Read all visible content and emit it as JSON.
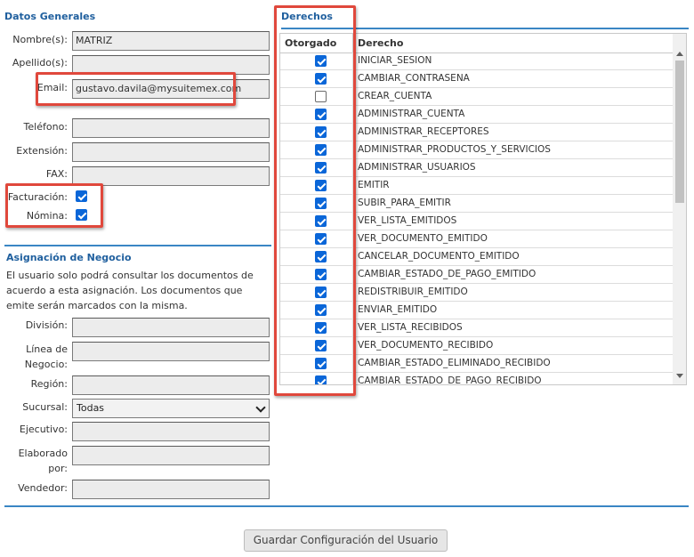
{
  "datos_generales": {
    "title": "Datos Generales",
    "nombre": {
      "label": "Nombre(s):",
      "value": "MATRIZ"
    },
    "apellido": {
      "label": "Apellido(s):",
      "value": ""
    },
    "email": {
      "label": "Email:",
      "value": "gustavo.davila@mysuitemex.com"
    },
    "telefono": {
      "label": "Teléfono:",
      "value": ""
    },
    "extension": {
      "label": "Extensión:",
      "value": ""
    },
    "fax": {
      "label": "FAX:",
      "value": ""
    },
    "facturacion": {
      "label": "Facturación:",
      "checked": true
    },
    "nomina": {
      "label": "Nómina:",
      "checked": true
    }
  },
  "asignacion": {
    "title": "Asignación de Negocio",
    "description": "El usuario solo podrá consultar los documentos de acuerdo a esta asignación. Los documentos que emite serán marcados con la misma.",
    "division": {
      "label": "División:",
      "value": ""
    },
    "linea_1": "Línea de",
    "linea_2": "Negocio:",
    "linea_value": "",
    "region": {
      "label": "Región:",
      "value": ""
    },
    "sucursal": {
      "label": "Sucursal:",
      "value": "Todas"
    },
    "ejecutivo": {
      "label": "Ejecutivo:",
      "value": ""
    },
    "elaborado_1": "Elaborado",
    "elaborado_2": "por:",
    "elaborado_value": "",
    "vendedor": {
      "label": "Vendedor:",
      "value": ""
    }
  },
  "derechos": {
    "title": "Derechos",
    "col_otorgado": "Otorgado",
    "col_derecho": "Derecho",
    "rows": [
      {
        "name": "INICIAR_SESION",
        "checked": true
      },
      {
        "name": "CAMBIAR_CONTRASENA",
        "checked": true
      },
      {
        "name": "CREAR_CUENTA",
        "checked": false
      },
      {
        "name": "ADMINISTRAR_CUENTA",
        "checked": true
      },
      {
        "name": "ADMINISTRAR_RECEPTORES",
        "checked": true
      },
      {
        "name": "ADMINISTRAR_PRODUCTOS_Y_SERVICIOS",
        "checked": true
      },
      {
        "name": "ADMINISTRAR_USUARIOS",
        "checked": true
      },
      {
        "name": "EMITIR",
        "checked": true
      },
      {
        "name": "SUBIR_PARA_EMITIR",
        "checked": true
      },
      {
        "name": "VER_LISTA_EMITIDOS",
        "checked": true
      },
      {
        "name": "VER_DOCUMENTO_EMITIDO",
        "checked": true
      },
      {
        "name": "CANCELAR_DOCUMENTO_EMITIDO",
        "checked": true
      },
      {
        "name": "CAMBIAR_ESTADO_DE_PAGO_EMITIDO",
        "checked": true
      },
      {
        "name": "REDISTRIBUIR_EMITIDO",
        "checked": true
      },
      {
        "name": "ENVIAR_EMITIDO",
        "checked": true
      },
      {
        "name": "VER_LISTA_RECIBIDOS",
        "checked": true
      },
      {
        "name": "VER_DOCUMENTO_RECIBIDO",
        "checked": true
      },
      {
        "name": "CAMBIAR_ESTADO_ELIMINADO_RECIBIDO",
        "checked": true
      },
      {
        "name": "CAMBIAR_ESTADO_DE_PAGO_RECIBIDO",
        "checked": true
      }
    ]
  },
  "save_button": "Guardar Configuración del Usuario",
  "colors": {
    "accent": "#3a86c4",
    "highlight": "#e0483c",
    "checkbox": "#0a66d8"
  }
}
